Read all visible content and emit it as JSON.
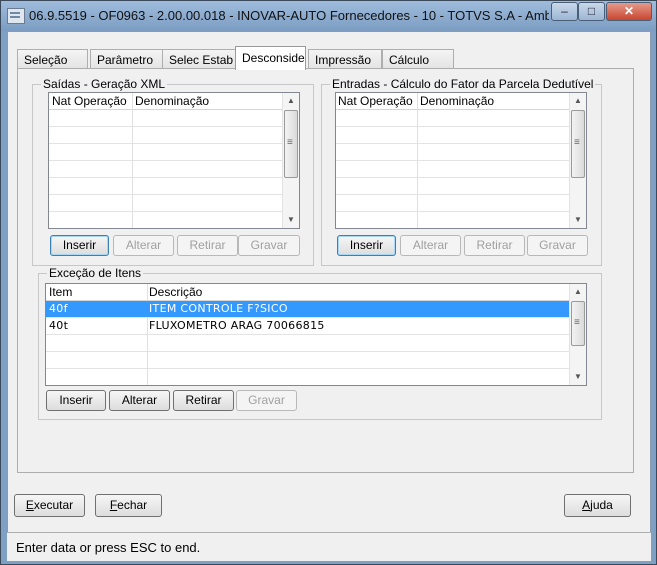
{
  "window": {
    "title": "06.9.5519 - OF0963 - 2.00.00.018 - INOVAR-AUTO Fornecedores - 10 - TOTVS S.A - Ambiente C...",
    "minimize_glyph": "–",
    "maximize_glyph": "□",
    "close_glyph": "✕"
  },
  "tabs": [
    {
      "label": "Seleção"
    },
    {
      "label": "Parâmetro"
    },
    {
      "label": "Selec Estab"
    },
    {
      "label": "Desconsidera"
    },
    {
      "label": "Impressão"
    },
    {
      "label": "Cálculo"
    }
  ],
  "active_tab": "Desconsidera",
  "saidas": {
    "title": "Saídas - Geração XML",
    "columns": [
      "Nat Operação",
      "Denominação"
    ],
    "rows": [],
    "buttons": {
      "insert": "Inserir",
      "alter": "Alterar",
      "remove": "Retirar",
      "save": "Gravar"
    }
  },
  "entradas": {
    "title": "Entradas - Cálculo do Fator da Parcela Dedutível",
    "columns": [
      "Nat Operação",
      "Denominação"
    ],
    "rows": [],
    "buttons": {
      "insert": "Inserir",
      "alter": "Alterar",
      "remove": "Retirar",
      "save": "Gravar"
    }
  },
  "excecao": {
    "title": "Exceção de Itens",
    "columns": [
      "Item",
      "Descrição"
    ],
    "rows": [
      {
        "item": "40f",
        "descricao": "ITEM CONTROLE F?SICO",
        "selected": true
      },
      {
        "item": "40t",
        "descricao": "FLUXOMETRO ARAG 70066815",
        "selected": false
      }
    ],
    "buttons": {
      "insert": "Inserir",
      "alter": "Alterar",
      "remove": "Retirar",
      "save": "Gravar"
    }
  },
  "footer": {
    "execute_prefix": "",
    "execute_mnemonic": "E",
    "execute_rest": "xecutar",
    "close_mnemonic": "F",
    "close_rest": "echar",
    "help_mnemonic": "A",
    "help_rest": "juda"
  },
  "status": {
    "text": "Enter data or press ESC to end."
  },
  "colors": {
    "selection": "#3399ff",
    "titlebar": "#7ea0c4",
    "close_button": "#c8462f"
  }
}
